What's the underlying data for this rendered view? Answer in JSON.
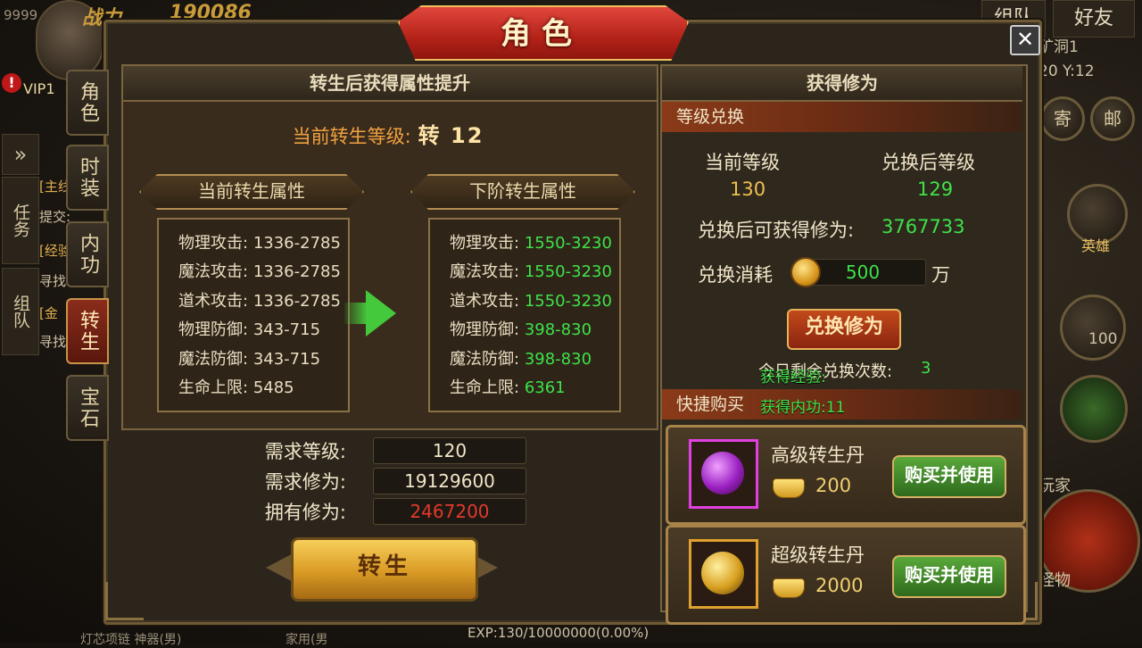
{
  "hud": {
    "level_badge": "9999",
    "power_label": "战力",
    "power_value": "190086",
    "vip": "VIP1",
    "team_tab": "组队",
    "friend_tab": "好友",
    "map_name": "矿洞1",
    "coords": "20 Y:12",
    "mail_a": "寄",
    "mail_b": "邮",
    "quest_tab": "任务",
    "team_side_tab": "组队",
    "quest_line1": "[主线",
    "quest_line2": "提交:",
    "quest_line3": "[经验",
    "quest_line4": "寻找",
    "quest_line5": "[金",
    "quest_line6": "寻找",
    "hero_label": "英雄",
    "skill_count": "100",
    "player_label": "玩家",
    "monster_label": "怪物",
    "exp_bar": "EXP:130/10000000(0.00%)",
    "bottom_text_a": "灯芯项链 神器(男)",
    "bottom_text_b": "家用(男"
  },
  "dialog": {
    "title": "角色",
    "close_label": "✕",
    "tabs": [
      {
        "label": "角色",
        "active": false
      },
      {
        "label": "时装",
        "active": false
      },
      {
        "label": "内功",
        "active": false
      },
      {
        "label": "转生",
        "active": true
      },
      {
        "label": "宝石",
        "active": false
      }
    ]
  },
  "rebirth": {
    "header": "转生后获得属性提升",
    "level_label": "当前转生等级:",
    "level_value": "转 12",
    "current_title": "当前转生属性",
    "next_title": "下阶转生属性",
    "current_attrs": [
      {
        "label": "物理攻击:",
        "value": "1336-2785"
      },
      {
        "label": "魔法攻击:",
        "value": "1336-2785"
      },
      {
        "label": "道术攻击:",
        "value": "1336-2785"
      },
      {
        "label": "物理防御:",
        "value": "343-715"
      },
      {
        "label": "魔法防御:",
        "value": "343-715"
      },
      {
        "label": "生命上限:",
        "value": "5485"
      }
    ],
    "next_attrs": [
      {
        "label": "物理攻击:",
        "value": "1550-3230"
      },
      {
        "label": "魔法攻击:",
        "value": "1550-3230"
      },
      {
        "label": "道术攻击:",
        "value": "1550-3230"
      },
      {
        "label": "物理防御:",
        "value": "398-830"
      },
      {
        "label": "魔法防御:",
        "value": "398-830"
      },
      {
        "label": "生命上限:",
        "value": "6361"
      }
    ],
    "req_level_label": "需求等级:",
    "req_level_value": "120",
    "req_cult_label": "需求修为:",
    "req_cult_value": "19129600",
    "own_cult_label": "拥有修为:",
    "own_cult_value": "2467200",
    "action_label": "转生"
  },
  "cultivation": {
    "header": "获得修为",
    "exchange_bar": "等级兑换",
    "cur_level_label": "当前等级",
    "cur_level_value": "130",
    "after_level_label": "兑换后等级",
    "after_level_value": "129",
    "gain_label": "兑换后可获得修为:",
    "gain_value": "3767733",
    "cost_label": "兑换消耗",
    "cost_value": "500",
    "cost_unit": "万",
    "exchange_button": "兑换修为",
    "remaining_label": "今日剩余兑换次数:",
    "remaining_value": "3",
    "float_exp": "获得经验:",
    "float_neigong": "获得内功:11"
  },
  "shop": {
    "bar": "快捷购买",
    "items": [
      {
        "name": "高级转生丹",
        "price": "200",
        "button": "购买并使用",
        "color": "#e040e0"
      },
      {
        "name": "超级转生丹",
        "price": "2000",
        "button": "购买并使用",
        "color": "#e0a030"
      }
    ]
  },
  "colors": {
    "accent_green": "#3ee24a",
    "accent_red": "#e23a2a",
    "title_red": "#b32218",
    "gold": "#f0c050"
  }
}
